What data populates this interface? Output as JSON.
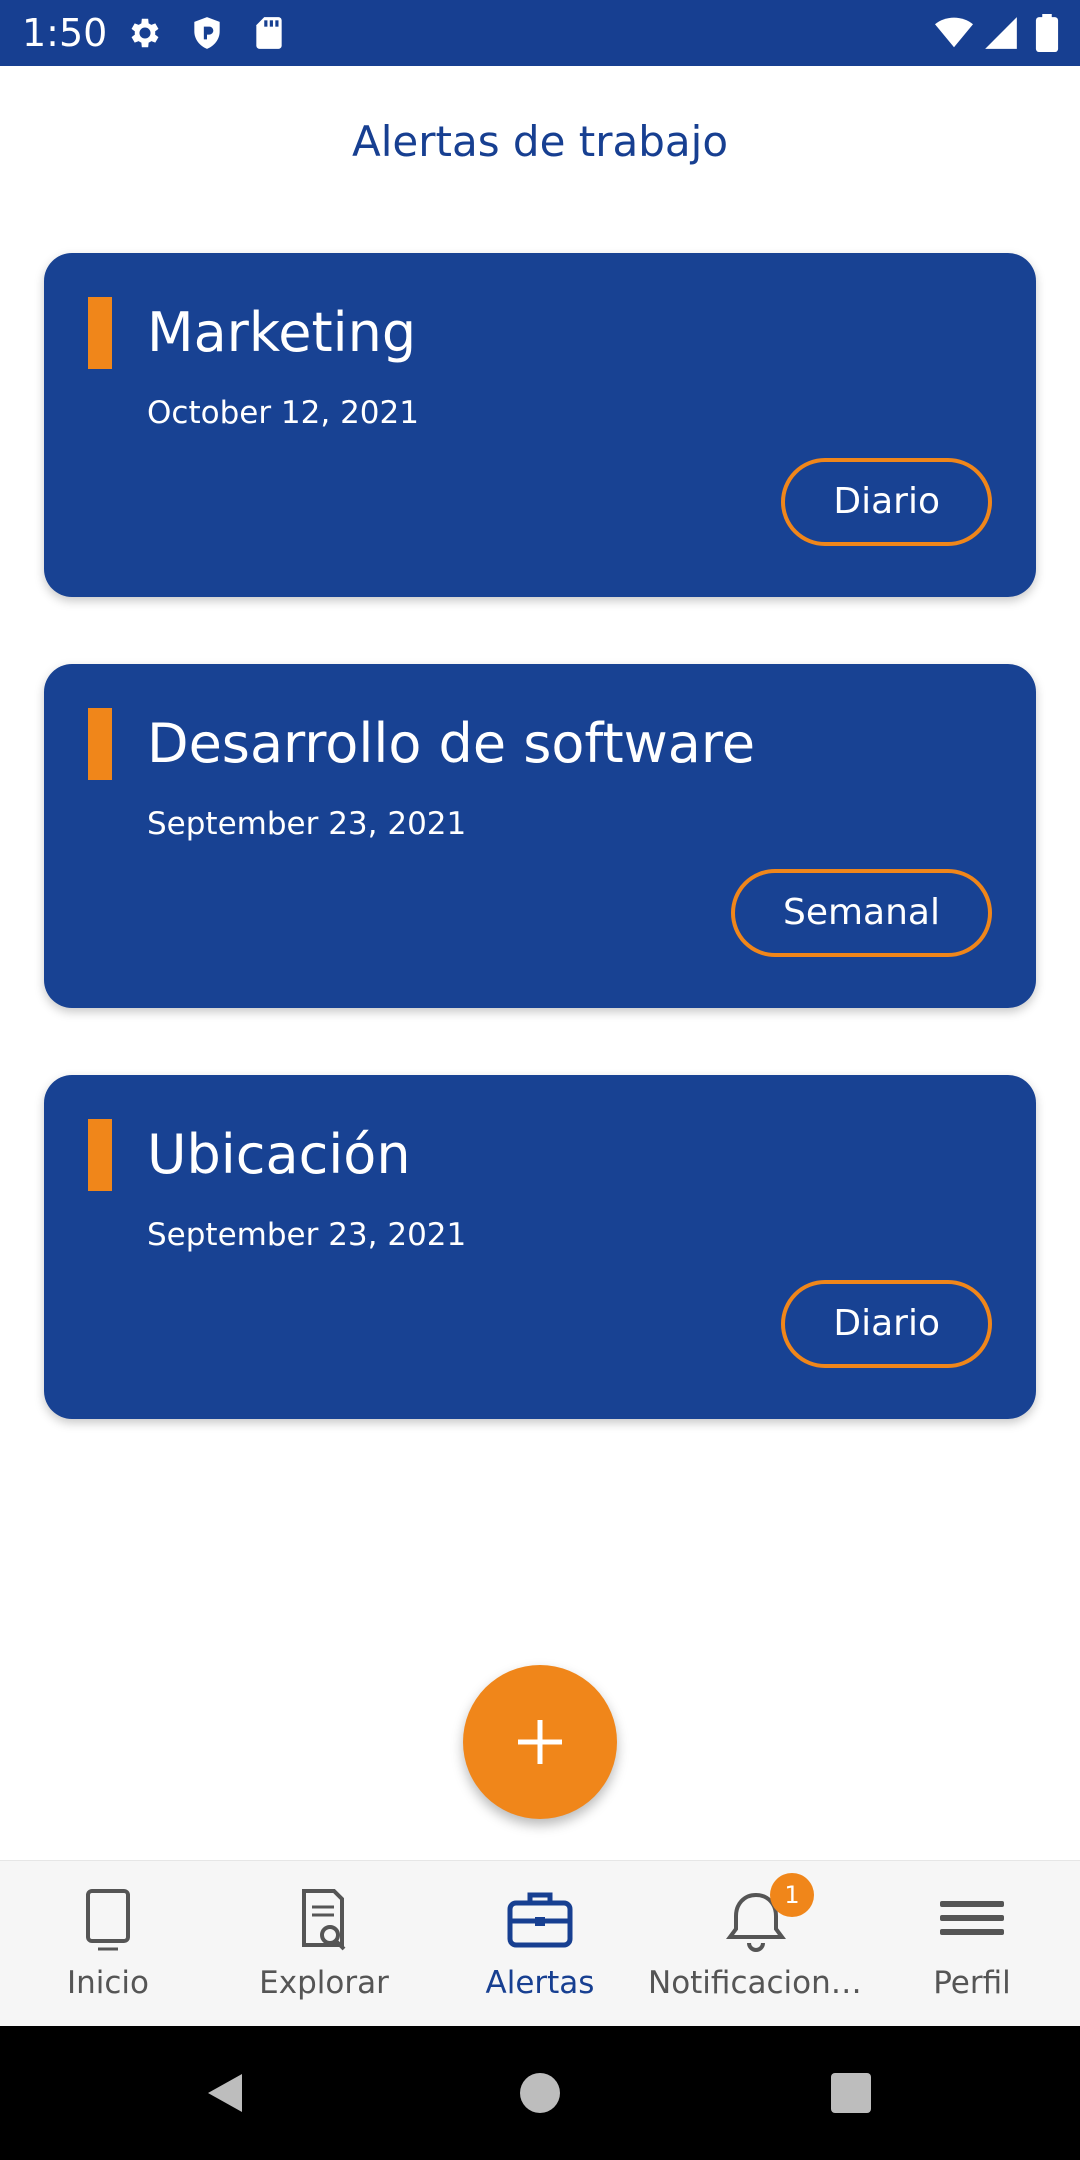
{
  "status_bar": {
    "time": "1:50",
    "left_icons": [
      "gear-icon",
      "shield-icon",
      "sd-card-icon"
    ],
    "right_icons": [
      "wifi-icon",
      "signal-icon",
      "battery-icon"
    ]
  },
  "header": {
    "title": "Alertas de trabajo"
  },
  "alerts": [
    {
      "title": "Marketing",
      "date": "October 12, 2021",
      "frequency": "Diario"
    },
    {
      "title": "Desarrollo de software",
      "date": "September 23, 2021",
      "frequency": "Semanal"
    },
    {
      "title": "Ubicación",
      "date": "September 23, 2021",
      "frequency": "Diario"
    }
  ],
  "fab": {
    "icon": "plus-icon"
  },
  "bottom_nav": {
    "active": "Alertas",
    "items": [
      {
        "label": "Inicio",
        "icon": "tablet-icon"
      },
      {
        "label": "Explorar",
        "icon": "document-search-icon"
      },
      {
        "label": "Alertas",
        "icon": "briefcase-icon"
      },
      {
        "label": "Notificaciones",
        "icon": "bell-icon",
        "badge": "1"
      },
      {
        "label": "Perfil",
        "icon": "menu-icon"
      }
    ]
  },
  "colors": {
    "primary": "#173f91",
    "card": "#184293",
    "accent": "#f0861a",
    "nav_background": "#f6f6f6"
  },
  "system_nav": {
    "buttons": [
      "back-icon",
      "home-icon",
      "recents-icon"
    ]
  }
}
